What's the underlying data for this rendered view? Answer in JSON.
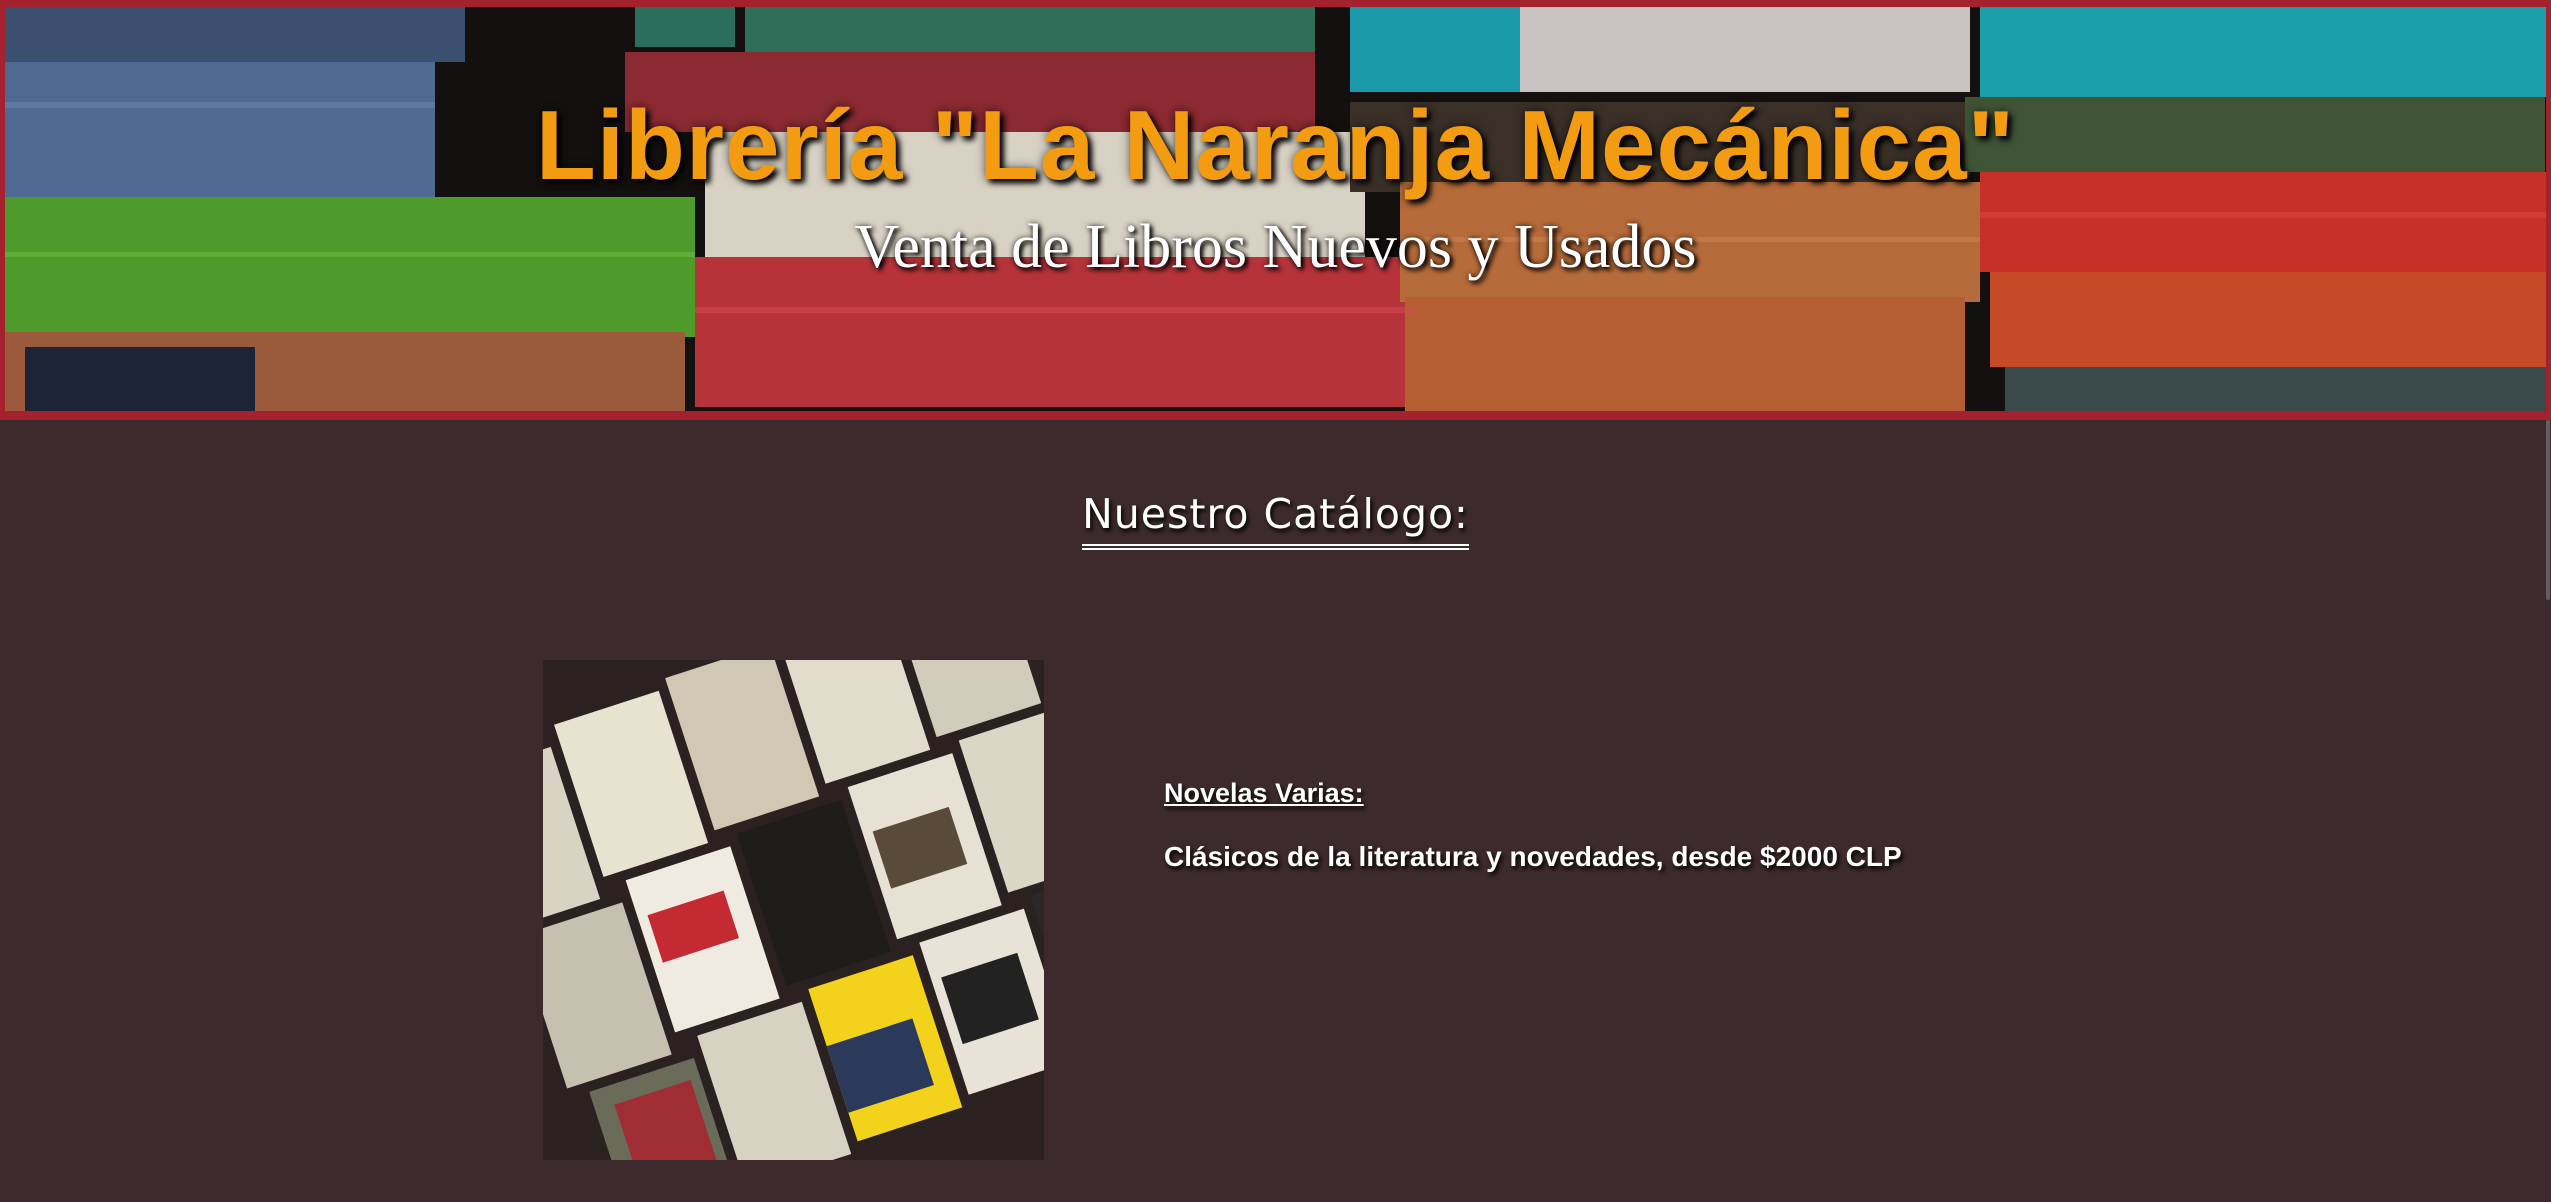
{
  "header": {
    "title": "Librería \"La Naranja Mecánica\"",
    "subtitle": "Venta de Libros Nuevos y Usados"
  },
  "catalog": {
    "heading": "Nuestro Catálogo:",
    "items": [
      {
        "name": "Novelas Varias:",
        "description": "Clásicos de la literatura y novedades, desde $2000 CLP"
      }
    ]
  },
  "colors": {
    "background": "#3d2a2c",
    "banner_border": "#a3222d",
    "title_orange": "#f39c12",
    "text": "#ffffff"
  }
}
